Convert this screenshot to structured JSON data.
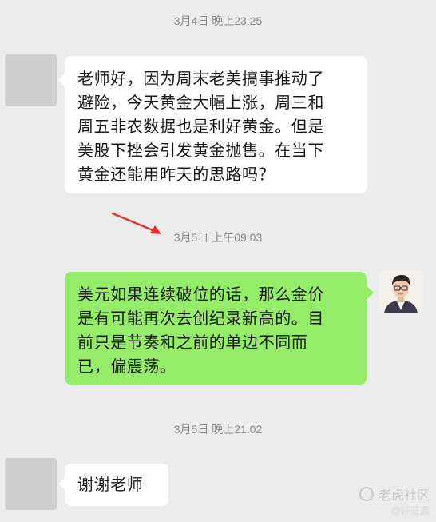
{
  "conversation": {
    "timestamps": [
      "3月4日 晚上23:25",
      "3月5日 上午09:03",
      "3月5日 晚上21:02"
    ],
    "messages": [
      {
        "sender": "student",
        "side": "left",
        "lines": [
          "老师好，因为周末老美搞事推动了",
          "避险，今天黄金大幅上涨，周三和",
          "周五非农数据也是利好黄金。但是",
          "美股下挫会引发黄金抛售。在当下",
          "黄金还能用昨天的思路吗？"
        ]
      },
      {
        "sender": "teacher",
        "side": "right",
        "lines": [
          "美元如果连续破位的话，那么金价",
          "是有可能再次去创纪录新高的。目",
          "前只是节奏和之前的单边不同而",
          "已，偏震荡。"
        ]
      },
      {
        "sender": "student",
        "side": "left",
        "lines": [
          "谢谢老师"
        ]
      }
    ]
  },
  "watermark": {
    "brand": "老虎社区",
    "handle": "@许亚鑫"
  },
  "colors": {
    "background": "#ececec",
    "left_bubble": "#ffffff",
    "right_bubble": "#95ec69",
    "timestamp_text": "#8a8a8a",
    "annotation_arrow": "#e0322b"
  },
  "icons": {
    "annotation": "red-arrow-icon",
    "teacher_avatar": "teacher-avatar-photo",
    "watermark_logo": "tiger-logo-icon"
  }
}
